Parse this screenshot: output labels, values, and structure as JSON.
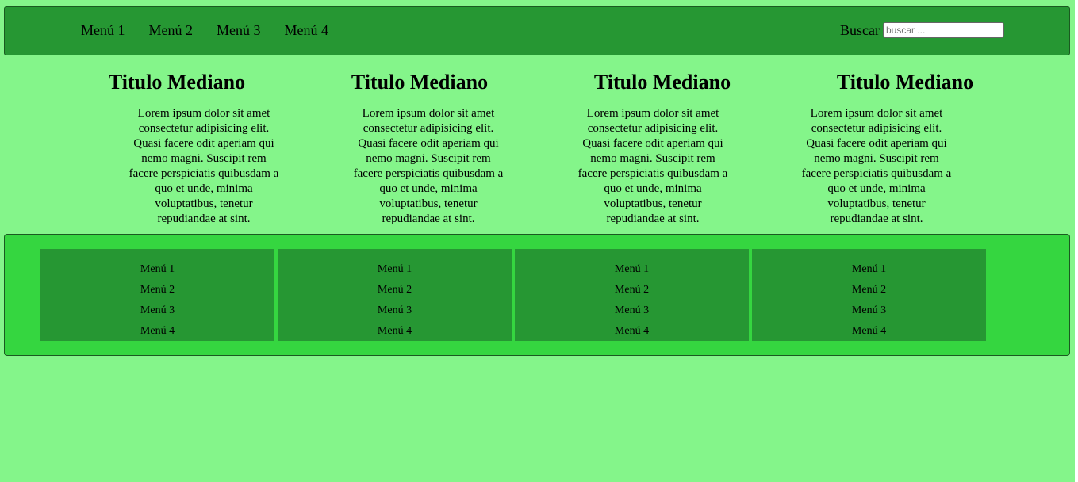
{
  "header": {
    "nav": [
      "Menú 1",
      "Menú 2",
      "Menú 3",
      "Menú 4"
    ],
    "search": {
      "label": "Buscar",
      "placeholder": "buscar ...",
      "value": ""
    }
  },
  "columns": [
    {
      "title": "Titulo Mediano",
      "text": "Lorem ipsum dolor sit amet consectetur adipisicing elit. Quasi facere odit aperiam qui nemo magni. Suscipit rem facere perspiciatis quibusdam a quo et unde, minima voluptatibus, tenetur repudiandae at sint."
    },
    {
      "title": "Titulo Mediano",
      "text": "Lorem ipsum dolor sit amet consectetur adipisicing elit. Quasi facere odit aperiam qui nemo magni. Suscipit rem facere perspiciatis quibusdam a quo et unde, minima voluptatibus, tenetur repudiandae at sint."
    },
    {
      "title": "Titulo Mediano",
      "text": "Lorem ipsum dolor sit amet consectetur adipisicing elit. Quasi facere odit aperiam qui nemo magni. Suscipit rem facere perspiciatis quibusdam a quo et unde, minima voluptatibus, tenetur repudiandae at sint."
    },
    {
      "title": "Titulo Mediano",
      "text": "Lorem ipsum dolor sit amet consectetur adipisicing elit. Quasi facere odit aperiam qui nemo magni. Suscipit rem facere perspiciatis quibusdam a quo et unde, minima voluptatibus, tenetur repudiandae at sint."
    }
  ],
  "footer": {
    "columns": [
      {
        "items": [
          "Menú 1",
          "Menú 2",
          "Menú 3",
          "Menú 4"
        ]
      },
      {
        "items": [
          "Menú 1",
          "Menú 2",
          "Menú 3",
          "Menú 4"
        ]
      },
      {
        "items": [
          "Menú 1",
          "Menú 2",
          "Menú 3",
          "Menú 4"
        ]
      },
      {
        "items": [
          "Menú 1",
          "Menú 2",
          "Menú 3",
          "Menú 4"
        ]
      }
    ]
  },
  "colors": {
    "page_background": "#84f58a",
    "header_background": "#269733",
    "footer_background": "#35d640",
    "footer_column_background": "#269733"
  }
}
